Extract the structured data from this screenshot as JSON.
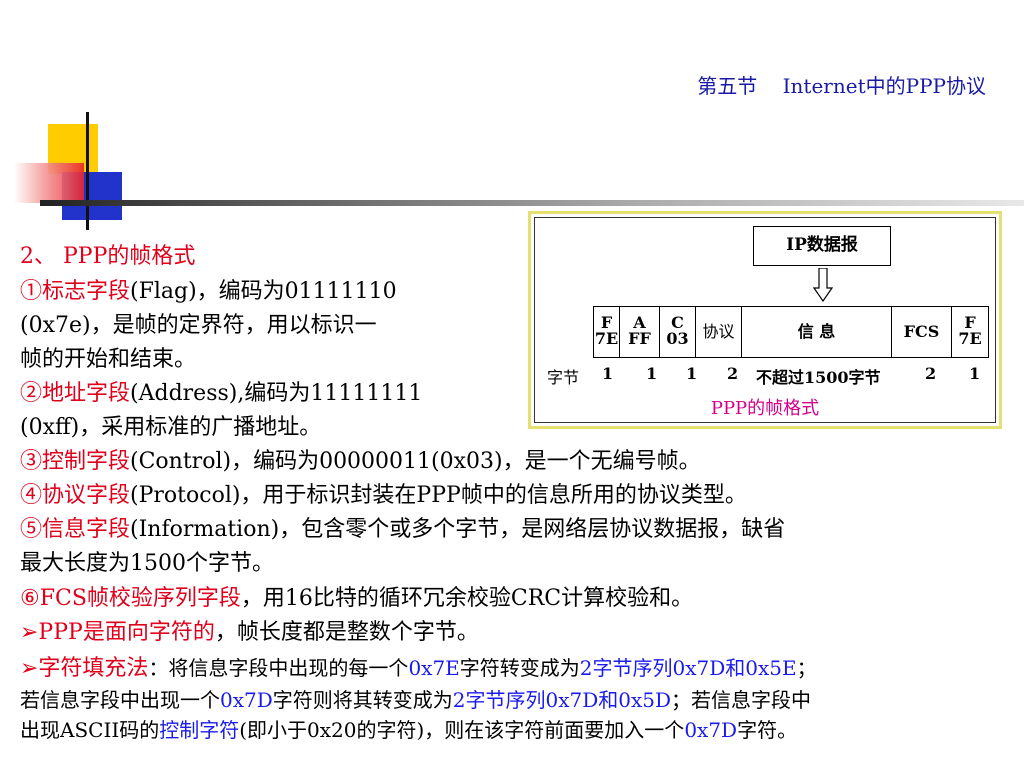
{
  "header": {
    "title": "第五节    Internet中的PPP协议"
  },
  "section": {
    "heading": "2、 PPP的帧格式"
  },
  "items": {
    "flag_label": "①标志字段",
    "flag_text_1": "(Flag)，编码为01111110",
    "flag_text_2": "(0x7e)，是帧的定界符，用以标识一",
    "flag_text_3": "帧的开始和结束。",
    "addr_label": "②地址字段",
    "addr_text_1": "(Address),编码为11111111",
    "addr_text_2": "(0xff)，采用标准的广播地址。",
    "ctrl_label": "③控制字段",
    "ctrl_text": "(Control)，编码为00000011(0x03)，是一个无编号帧。",
    "proto_label": "④协议字段",
    "proto_text": "(Protocol)，用于标识封装在PPP帧中的信息所用的协议类型。",
    "info_label": "⑤信息字段",
    "info_text_1": "(Information)，包含零个或多个字节，是网络层协议数据报，缺省",
    "info_text_2": "最大长度为1500个字节。",
    "fcs_label": "⑥FCS帧校验序列字段",
    "fcs_text": "，用16比特的循环冗余校验CRC计算校验和。",
    "char_prefix": "➢PPP是面向字符的",
    "char_text": "，帧长度都是整数个字节。",
    "stuff_label": "➢字符填充法",
    "stuff_1a": "：将信息字段中出现的每一个",
    "stuff_1b": "0x7E",
    "stuff_1c": "字符转变成为",
    "stuff_1d": "2字节序列0x7D和0x5E",
    "stuff_1e": "；",
    "stuff_2a": "若信息字段中出现一个",
    "stuff_2b": "0x7D",
    "stuff_2c": "字符则将其转变成为",
    "stuff_2d": "2字节序列0x7D和0x5D",
    "stuff_2e": "；若信息字段中",
    "stuff_3a": "出现ASCII码的",
    "stuff_3b": "控制字符",
    "stuff_3c": "(即小于0x20的字符)，则在该字符前面要加入一个",
    "stuff_3d": "0x7D",
    "stuff_3e": "字符。"
  },
  "diagram": {
    "ip_box": "IP数据报",
    "cells": {
      "f1_top": "F",
      "f1_bottom": "7E",
      "a_top": "A",
      "a_bottom": "FF",
      "c_top": "C",
      "c_bottom": "03",
      "proto": "协议",
      "info": "信 息",
      "fcs": "FCS",
      "f2_top": "F",
      "f2_bottom": "7E"
    },
    "bytes": {
      "label": "字节",
      "f1": "1",
      "a": "1",
      "c": "1",
      "proto": "2",
      "info": "不超过1500字节",
      "fcs": "2",
      "f2": "1"
    },
    "caption": "PPP的帧格式"
  },
  "colors": {
    "accent_red": "#e0001b",
    "accent_blue": "#1a1aee",
    "title_blue": "#1a1aa6",
    "caption_pink": "#d4008a"
  }
}
